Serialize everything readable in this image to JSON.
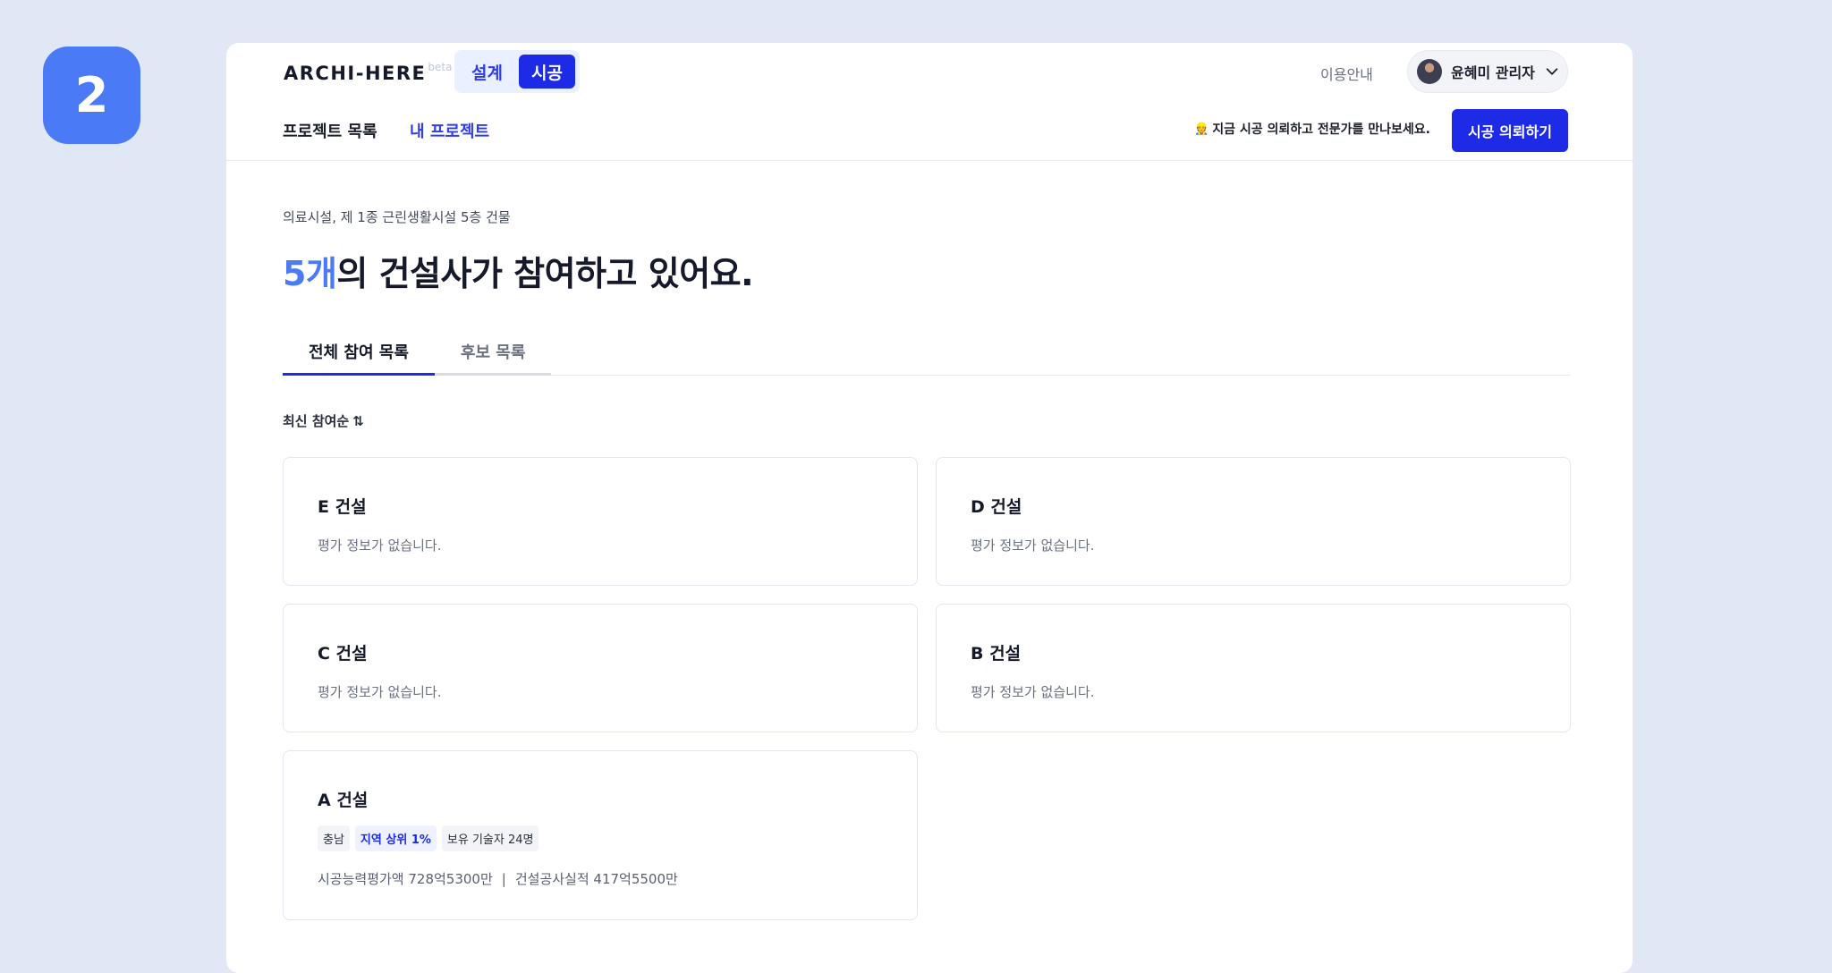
{
  "step": "2",
  "header": {
    "logo": "ARCHI-HERE",
    "logo_badge": "beta",
    "modes": [
      {
        "label": "설계",
        "active": false
      },
      {
        "label": "시공",
        "active": true
      }
    ],
    "guide_label": "이용안내",
    "user_name": "윤혜미 관리자",
    "nav": {
      "projects": "프로젝트 목록",
      "mine": "내 프로젝트"
    },
    "promo_text": "지금 시공 의뢰하고 전문가를 만나보세요.",
    "cta_label": "시공 의뢰하기"
  },
  "main": {
    "subtitle": "의료시설, 제 1종 근린생활시설 5층 건물",
    "headline_count": "5개",
    "headline_rest": "의 건설사가 참여하고 있어요.",
    "tabs": [
      {
        "label": "전체 참여 목록",
        "active": true
      },
      {
        "label": "후보 목록",
        "active": false
      }
    ],
    "sort_label": "최신 참여순",
    "companies": [
      {
        "name": "E 건설",
        "desc": "평가 정보가 없습니다."
      },
      {
        "name": "D 건설",
        "desc": "평가 정보가 없습니다."
      },
      {
        "name": "C 건설",
        "desc": "평가 정보가 없습니다."
      },
      {
        "name": "B 건설",
        "desc": "평가 정보가 없습니다."
      }
    ],
    "featured": {
      "name": "A 건설",
      "tags": [
        "충남",
        "지역 상위 1%",
        "보유 기술자 24명"
      ],
      "capacity": "시공능력평가액 728억5300만",
      "separator": "|",
      "record": "건설공사실적 417억5500만"
    }
  },
  "colors": {
    "accent": "#1d2ae6",
    "highlight": "#4a7af5",
    "badge": "#4a7af5"
  }
}
